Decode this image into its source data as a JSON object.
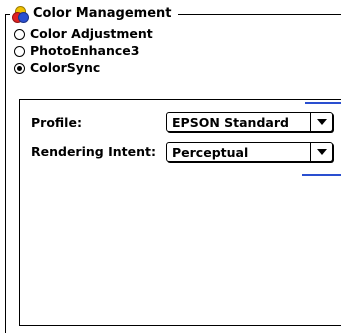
{
  "group": {
    "title": "Color Management"
  },
  "color_options": [
    {
      "label": "Color Adjustment",
      "selected": false
    },
    {
      "label": "PhotoEnhance3",
      "selected": false
    },
    {
      "label": "ColorSync",
      "selected": true
    }
  ],
  "colorsync": {
    "profile": {
      "label": "Profile:",
      "value": "EPSON Standard"
    },
    "rendering_intent": {
      "label": "Rendering Intent:",
      "value": "Perceptual"
    }
  },
  "colors": {
    "accent_line": "#2a4fd0"
  },
  "icons": {
    "group": "color-management-icon",
    "popup_arrow": "chevron-down-icon"
  }
}
